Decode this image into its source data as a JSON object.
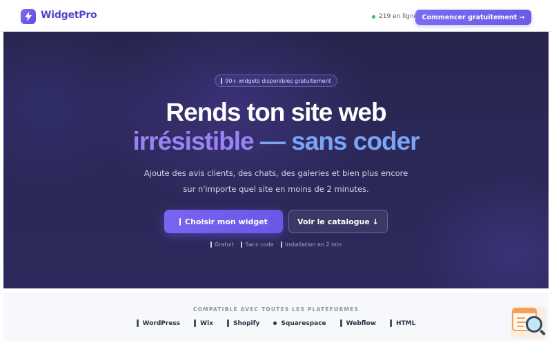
{
  "header": {
    "brand": "WidgetPro",
    "online_count": "219 en ligne",
    "cta_label": "Commencer gratuitement →",
    "logo_icon": "lightning-icon",
    "status_color": "#22c55e",
    "accent_color": "#6a5ae8"
  },
  "hero": {
    "badge": "90+ widgets disponibles gratuitement",
    "title_line1": "Rends ton site web",
    "title_line2_a": "irrésistible",
    "title_line2_b": "— sans coder",
    "subtitle": "Ajoute des avis clients, des chats, des galeries et bien plus encore sur n'importe quel site en moins de 2 minutes.",
    "primary_button": "Choisir mon widget",
    "secondary_button": "Voir le catalogue ↓",
    "features": [
      "Gratuit",
      "Sans code",
      "Installation en 2 min"
    ],
    "feature_separator": "·"
  },
  "platforms": {
    "title": "COMPATIBLE AVEC TOUTES LES PLATEFORMES",
    "items": [
      "WordPress",
      "Wix",
      "Shopify",
      "Squarespace",
      "Webflow",
      "HTML"
    ]
  }
}
